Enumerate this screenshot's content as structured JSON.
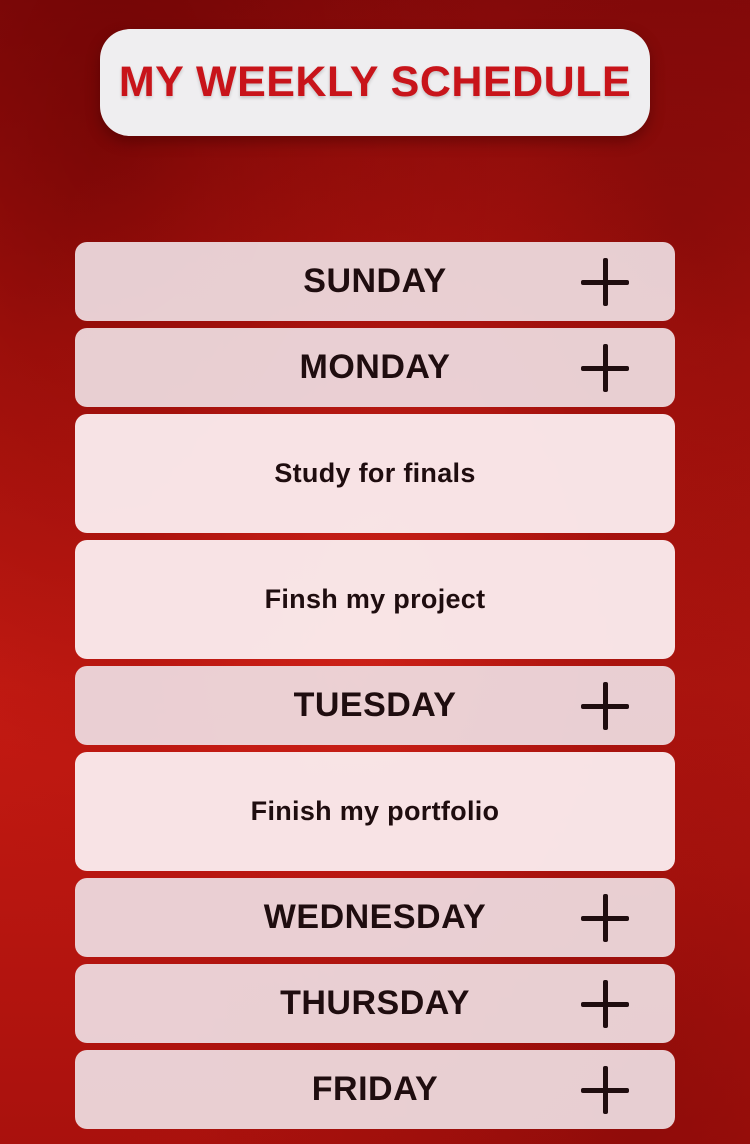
{
  "header": {
    "title": "MY WEEKLY SCHEDULE",
    "title_color": "#c8141a"
  },
  "days": {
    "sunday": {
      "label": "SUNDAY",
      "add_icon": "plus-icon"
    },
    "monday": {
      "label": "MONDAY",
      "add_icon": "plus-icon",
      "tasks": [
        "Study for finals",
        "Finsh my project"
      ]
    },
    "tuesday": {
      "label": "TUESDAY",
      "add_icon": "plus-icon",
      "tasks": [
        "Finish my portfolio"
      ]
    },
    "wednesday": {
      "label": "WEDNESDAY",
      "add_icon": "plus-icon"
    },
    "thursday": {
      "label": "THURSDAY",
      "add_icon": "plus-icon"
    },
    "friday": {
      "label": "FRIDAY",
      "add_icon": "plus-icon"
    }
  },
  "colors": {
    "background": "#b01010",
    "row_background": "#eedee2",
    "task_background": "#faeaec",
    "text": "#1f0d0f"
  }
}
